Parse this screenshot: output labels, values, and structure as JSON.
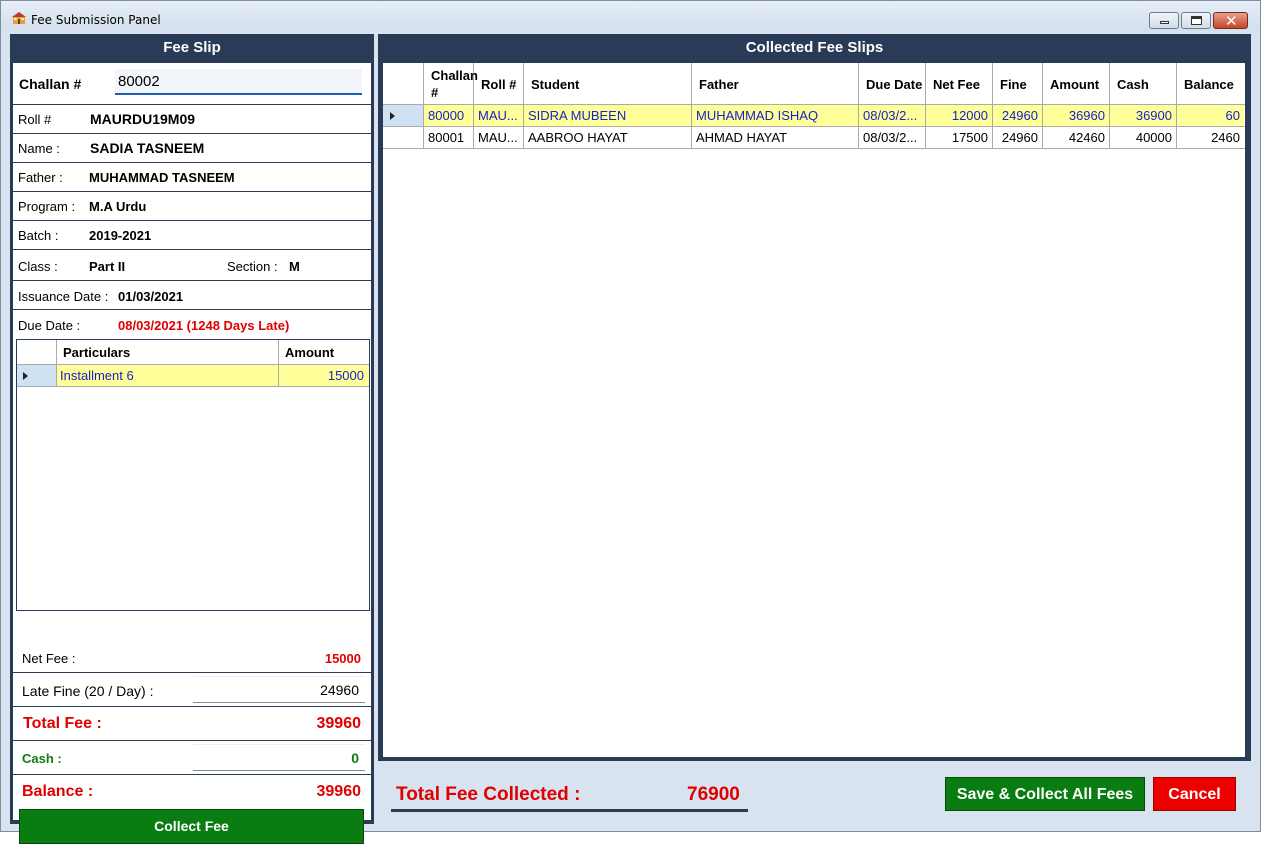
{
  "window": {
    "title": "Fee Submission Panel"
  },
  "fee_slip": {
    "header": "Fee Slip",
    "challan_label": "Challan #",
    "challan_value": "80002",
    "roll_label": "Roll #",
    "roll_value": "MAURDU19M09",
    "name_label": "Name :",
    "name_value": "SADIA TASNEEM",
    "father_label": "Father :",
    "father_value": "MUHAMMAD TASNEEM",
    "program_label": "Program :",
    "program_value": "M.A Urdu",
    "batch_label": "Batch :",
    "batch_value": "2019-2021",
    "class_label": "Class :",
    "class_value": "Part II",
    "section_label": "Section :",
    "section_value": "M",
    "issuance_label": "Issuance Date :",
    "issuance_value": "01/03/2021",
    "due_label": "Due Date :",
    "due_value": "08/03/2021 (1248 Days Late)",
    "particulars": {
      "col_particulars": "Particulars",
      "col_amount": "Amount",
      "rows": [
        {
          "particular": "Installment 6",
          "amount": "15000"
        }
      ]
    },
    "net_fee_label": "Net Fee :",
    "net_fee_value": "15000",
    "late_fine_label": "Late Fine (20 / Day) :",
    "late_fine_value": "24960",
    "total_fee_label": "Total Fee :",
    "total_fee_value": "39960",
    "cash_label": "Cash :",
    "cash_value": "0",
    "balance_label": "Balance :",
    "balance_value": "39960",
    "collect_button": "Collect Fee"
  },
  "collected": {
    "header": "Collected Fee Slips",
    "columns": {
      "challan": "Challan #",
      "roll": "Roll #",
      "student": "Student",
      "father": "Father",
      "due": "Due Date",
      "net": "Net Fee",
      "fine": "Fine",
      "amount": "Amount",
      "cash": "Cash",
      "balance": "Balance"
    },
    "rows": [
      {
        "challan": "80000",
        "roll": "MAU...",
        "student": "SIDRA MUBEEN",
        "father": "MUHAMMAD ISHAQ",
        "due": "08/03/2...",
        "net": "12000",
        "fine": "24960",
        "amount": "36960",
        "cash": "36900",
        "balance": "60"
      },
      {
        "challan": "80001",
        "roll": "MAU...",
        "student": "AABROO HAYAT",
        "father": "AHMAD HAYAT",
        "due": "08/03/2...",
        "net": "17500",
        "fine": "24960",
        "amount": "42460",
        "cash": "40000",
        "balance": "2460"
      }
    ]
  },
  "footer": {
    "total_label": "Total Fee Collected :",
    "total_value": "76900",
    "save_button": "Save & Collect All Fees",
    "cancel_button": "Cancel"
  },
  "colors": {
    "panel_dark": "#2a3b58",
    "accent_green": "#0a7d12",
    "accent_red": "#ee0000",
    "selection_yellow": "#ffff99",
    "selection_text": "#1a23c4"
  }
}
